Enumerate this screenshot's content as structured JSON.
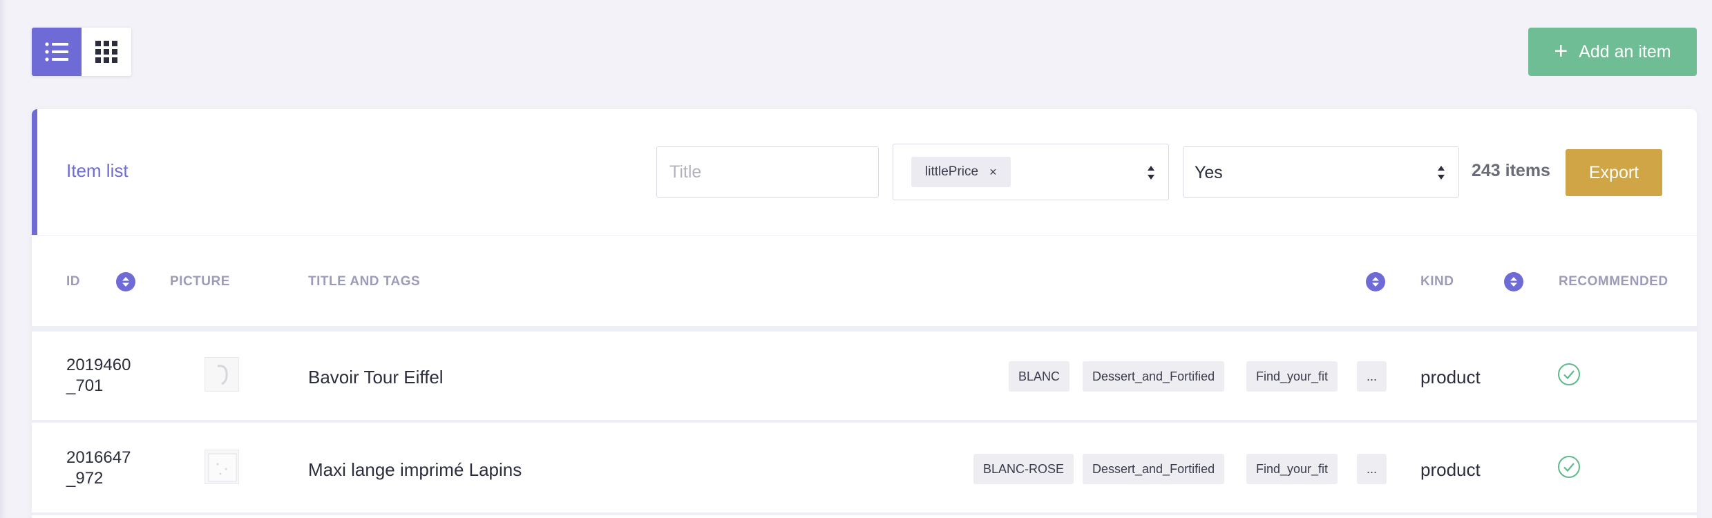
{
  "toolbar": {
    "add_button_label": "Add an item",
    "add_button_plus": "+"
  },
  "panel": {
    "title": "Item list",
    "title_filter_placeholder": "Title",
    "tag_filter_chip": "littlePrice",
    "tag_filter_remove": "×",
    "recommended_filter_value": "Yes",
    "item_count": "243 items",
    "export_label": "Export"
  },
  "table": {
    "headers": {
      "id": "ID",
      "picture": "PICTURE",
      "title_and_tags": "TITLE AND TAGS",
      "kind": "KIND",
      "recommended": "RECOMMENDED"
    },
    "rows": [
      {
        "id_line1": "2019460",
        "id_line2": "_701",
        "title": "Bavoir Tour Eiffel",
        "tags": [
          "BLANC",
          "Dessert_and_Fortified",
          "Find_your_fit",
          "..."
        ],
        "kind": "product",
        "recommended": true
      },
      {
        "id_line1": "2016647",
        "id_line2": "_972",
        "title": "Maxi lange imprimé Lapins",
        "tags": [
          "BLANC-ROSE",
          "Dessert_and_Fortified",
          "Find_your_fit",
          "..."
        ],
        "kind": "product",
        "recommended": true
      }
    ]
  },
  "colors": {
    "accent": "#6f6bd6",
    "add_button": "#6fbd94",
    "export_button": "#d0a546",
    "check": "#5fb98c"
  },
  "icons": {
    "list_view": "list-icon",
    "grid_view": "grid-icon",
    "sort": "sort-icon",
    "select_arrows": "updown-arrows-icon",
    "recommended": "check-circle-icon"
  }
}
